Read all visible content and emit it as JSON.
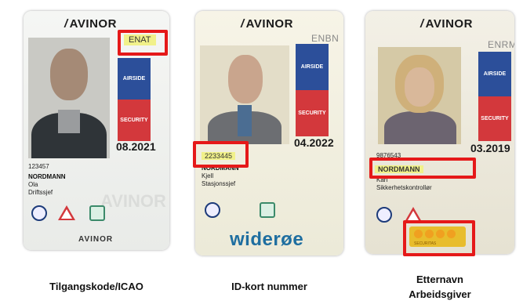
{
  "cards": [
    {
      "logo": "AVINOR",
      "code": "ENAT",
      "zone_top": "AIRSIDE",
      "zone_bottom": "SECURITY",
      "valid": "08.2021",
      "id_number": "123457",
      "surname": "NORDMANN",
      "firstname": "Ola",
      "role": "Driftssjef",
      "footer": "AVINOR",
      "watermark": "AVINOR"
    },
    {
      "logo": "AVINOR",
      "code": "ENBN",
      "zone_top": "AIRSIDE",
      "zone_bottom": "SECURITY",
      "valid": "04.2022",
      "id_number": "2233445",
      "surname": "NORDMANN",
      "firstname": "Kjell",
      "role": "Stasjonssjef",
      "footer": "widerøe"
    },
    {
      "logo": "AVINOR",
      "code": "ENRM",
      "zone_top": "AIRSIDE",
      "zone_bottom": "SECURITY",
      "valid": "03.2019",
      "id_number": "9876543",
      "surname": "NORDMANN",
      "firstname": "Kari",
      "role": "Sikkerhetskontrollør",
      "footer": "SECURITAS"
    }
  ],
  "captions": {
    "c1": "Tilgangskode/ICAO",
    "c2": "ID-kort nummer",
    "c3_line1": "Etternavn",
    "c3_line2": "Arbeidsgiver"
  },
  "colors": {
    "highlight_box": "#e51919",
    "airside_blue": "#2c4f9a",
    "security_red": "#d3383c",
    "highlight_yellow": "#f1f18a"
  }
}
